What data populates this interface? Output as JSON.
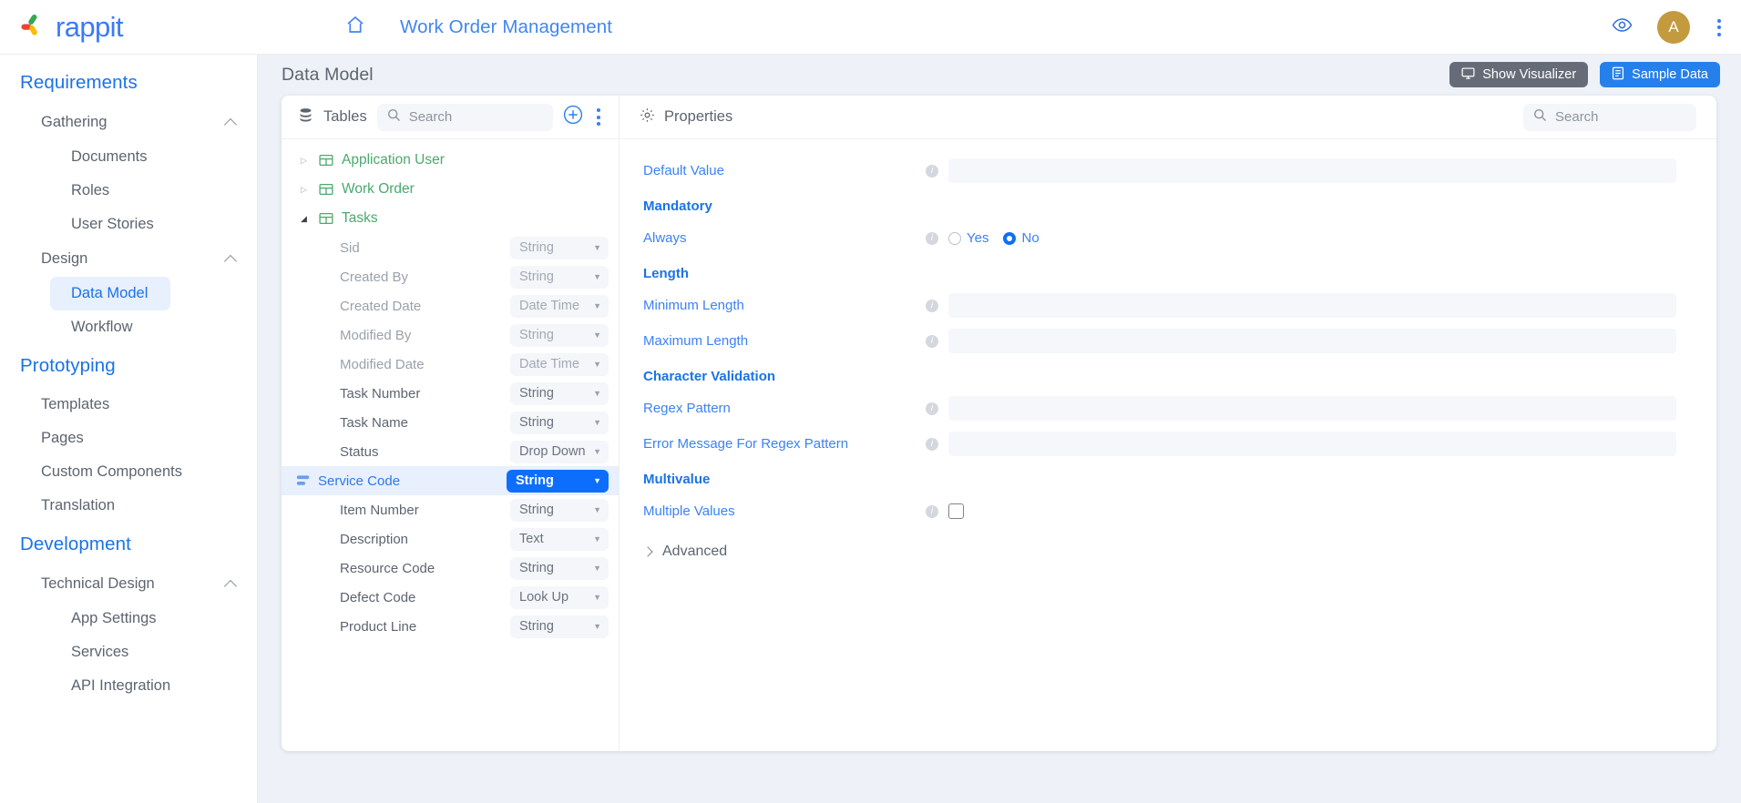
{
  "brand": {
    "name": "rappit",
    "color": "#3b7af7"
  },
  "topbar": {
    "home_icon": "home-icon",
    "app_title": "Work Order Management",
    "preview_icon": "eye-icon",
    "avatar_initial": "A",
    "menu_icon": "kebab-menu-icon"
  },
  "sidebar": {
    "sections": [
      {
        "label": "Requirements",
        "groups": [
          {
            "label": "Gathering",
            "expanded": true,
            "items": [
              "Documents",
              "Roles",
              "User Stories"
            ]
          },
          {
            "label": "Design",
            "expanded": true,
            "items": [
              "Data Model",
              "Workflow"
            ],
            "active": "Data Model"
          }
        ]
      },
      {
        "label": "Prototyping",
        "items": [
          "Templates",
          "Pages",
          "Custom Components",
          "Translation"
        ]
      },
      {
        "label": "Development",
        "groups": [
          {
            "label": "Technical Design",
            "expanded": true,
            "items": [
              "App Settings",
              "Services",
              "API Integration"
            ]
          }
        ]
      }
    ]
  },
  "main": {
    "page_title": "Data Model",
    "buttons": {
      "show_visualizer": "Show Visualizer",
      "sample_data": "Sample Data",
      "visualizer_icon": "monitor-icon",
      "sample_data_icon": "document-icon",
      "visualizer_color": "#656c78",
      "sample_data_color": "#2680eb"
    }
  },
  "tables_panel": {
    "icon": "database-icon",
    "title": "Tables",
    "search_placeholder": "Search",
    "search_value": "",
    "add_icon": "plus-circle-icon",
    "menu_icon": "kebab-menu-icon",
    "tree": [
      {
        "name": "Application User",
        "expanded": false
      },
      {
        "name": "Work Order",
        "expanded": false
      },
      {
        "name": "Tasks",
        "expanded": true
      }
    ],
    "fields": [
      {
        "name": "Sid",
        "type": "String",
        "disabled": true,
        "selected": false
      },
      {
        "name": "Created By",
        "type": "String",
        "disabled": true,
        "selected": false
      },
      {
        "name": "Created Date",
        "type": "Date Time",
        "disabled": true,
        "selected": false
      },
      {
        "name": "Modified By",
        "type": "String",
        "disabled": true,
        "selected": false
      },
      {
        "name": "Modified Date",
        "type": "Date Time",
        "disabled": true,
        "selected": false
      },
      {
        "name": "Task Number",
        "type": "String",
        "disabled": false,
        "selected": false
      },
      {
        "name": "Task Name",
        "type": "String",
        "disabled": false,
        "selected": false
      },
      {
        "name": "Status",
        "type": "Drop Down",
        "disabled": false,
        "selected": false
      },
      {
        "name": "Service Code",
        "type": "String",
        "disabled": false,
        "selected": true
      },
      {
        "name": "Item Number",
        "type": "String",
        "disabled": false,
        "selected": false
      },
      {
        "name": "Description",
        "type": "Text",
        "disabled": false,
        "selected": false
      },
      {
        "name": "Resource Code",
        "type": "String",
        "disabled": false,
        "selected": false
      },
      {
        "name": "Defect Code",
        "type": "Look Up",
        "disabled": false,
        "selected": false
      },
      {
        "name": "Product Line",
        "type": "String",
        "disabled": false,
        "selected": false
      }
    ]
  },
  "properties_panel": {
    "icon": "gear-icon",
    "title": "Properties",
    "search_placeholder": "Search",
    "search_value": "",
    "rows": [
      {
        "kind": "input",
        "label": "Default Value",
        "value": "",
        "info": "i"
      },
      {
        "kind": "group",
        "label": "Mandatory"
      },
      {
        "kind": "radio",
        "label": "Always",
        "info": "i",
        "options": [
          "Yes",
          "No"
        ],
        "selected": "No"
      },
      {
        "kind": "group",
        "label": "Length"
      },
      {
        "kind": "input",
        "label": "Minimum Length",
        "value": "",
        "info": "i"
      },
      {
        "kind": "input",
        "label": "Maximum Length",
        "value": "",
        "info": "i"
      },
      {
        "kind": "group",
        "label": "Character Validation"
      },
      {
        "kind": "input",
        "label": "Regex Pattern",
        "value": "",
        "info": "i"
      },
      {
        "kind": "input",
        "label": "Error Message For Regex Pattern",
        "value": "",
        "info": "i"
      },
      {
        "kind": "group",
        "label": "Multivalue"
      },
      {
        "kind": "checkbox",
        "label": "Multiple Values",
        "info": "i",
        "checked": false
      }
    ],
    "advanced_label": "Advanced",
    "advanced_expanded": false
  }
}
